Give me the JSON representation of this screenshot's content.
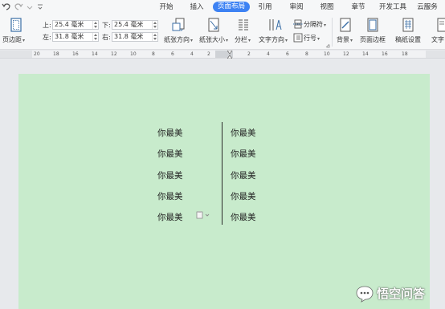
{
  "menu": {
    "tabs": [
      {
        "label": "开始"
      },
      {
        "label": "插入"
      },
      {
        "label": "页面布局"
      },
      {
        "label": "引用"
      },
      {
        "label": "审阅"
      },
      {
        "label": "视图"
      },
      {
        "label": "章节"
      },
      {
        "label": "开发工具"
      },
      {
        "label": "云服务"
      }
    ],
    "active_color": "#3d82f3"
  },
  "ribbon": {
    "margins_button": "页边距",
    "margin_fields": {
      "top": {
        "label": "上:",
        "value": "25.4 毫米"
      },
      "bottom": {
        "label": "下:",
        "value": "25.4 毫米"
      },
      "left": {
        "label": "左:",
        "value": "31.8 毫米"
      },
      "right": {
        "label": "右:",
        "value": "31.8 毫米"
      }
    },
    "orientation": "纸张方向",
    "size": "纸张大小",
    "columns": "分栏",
    "text_direction": "文字方向",
    "breaks": "分隔符",
    "line_numbers": "行号",
    "background": "背景",
    "page_border": "页面边框",
    "page_setup": "稿纸设置",
    "overflow": "文字"
  },
  "ruler": {
    "left_numbers": [
      "20",
      "18",
      "16",
      "14",
      "12",
      "10",
      "8",
      "6",
      "4",
      "2"
    ],
    "right_numbers": [
      "2",
      "4",
      "6",
      "8",
      "10",
      "12",
      "14",
      "16",
      "18"
    ]
  },
  "document": {
    "background_color": "#c8ebcc",
    "left_column": [
      "你最美",
      "你最美",
      "你最美",
      "你最美",
      "你最美"
    ],
    "right_column": [
      "你最美",
      "你最美",
      "你最美",
      "你最美",
      "你最美"
    ]
  },
  "watermark": {
    "text": "悟空问答"
  }
}
